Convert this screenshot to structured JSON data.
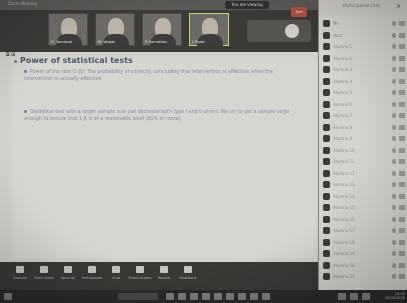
{
  "window": {
    "title": "Zoom Meeting",
    "share_banner": "You are viewing screen"
  },
  "gallery": {
    "tiles": [
      {
        "name": "G. Sandoval"
      },
      {
        "name": "M. Vargas"
      },
      {
        "name": "P. Sarmiento"
      },
      {
        "name": "J. Rojas"
      }
    ]
  },
  "slide": {
    "tools": "⧉ ⊞",
    "heading": "Power of statistical tests",
    "bullet_1": "Power of the test (1-β): The probability of correctly concluding that intervention is effective when the intervention is actually effective",
    "bullet_2": "Statistical test with a larger sample size can decrease both type I and II errors. We try to get a sample large enough to ensure that 1-β is at a reasonable level (80% or more)."
  },
  "toolbar": {
    "items": [
      {
        "label": "Unmute",
        "icon": "mic-icon"
      },
      {
        "label": "Start Video",
        "icon": "camera-icon"
      },
      {
        "label": "Security",
        "icon": "shield-icon"
      },
      {
        "label": "Participants",
        "icon": "people-icon"
      },
      {
        "label": "Chat",
        "icon": "chat-icon"
      },
      {
        "label": "Share Screen",
        "icon": "share-icon"
      },
      {
        "label": "Record",
        "icon": "record-icon"
      },
      {
        "label": "Reactions",
        "icon": "smile-icon"
      }
    ],
    "end_label": "End"
  },
  "panel": {
    "title": "Participants (14)",
    "close_glyph": "×",
    "participants": [
      {
        "name": "Me"
      },
      {
        "name": "Host"
      },
      {
        "name": "Alumno 1"
      },
      {
        "name": "Alumno 2"
      },
      {
        "name": "Alumno 3"
      },
      {
        "name": "Alumno 4"
      },
      {
        "name": "Alumno 5"
      },
      {
        "name": "Alumno 6"
      },
      {
        "name": "Alumno 7"
      },
      {
        "name": "Alumno 8"
      },
      {
        "name": "Alumno 9"
      },
      {
        "name": "Alumno 10"
      },
      {
        "name": "Alumno 11"
      },
      {
        "name": "Alumno 12"
      },
      {
        "name": "Alumno 13"
      },
      {
        "name": "Alumno 14"
      },
      {
        "name": "Alumno 15"
      },
      {
        "name": "Alumno 16"
      },
      {
        "name": "Alumno 17"
      },
      {
        "name": "Alumno 18"
      },
      {
        "name": "Alumno 19"
      },
      {
        "name": "Alumno 20"
      },
      {
        "name": "Alumno 21"
      }
    ]
  },
  "taskbar": {
    "time": "10:42",
    "date": "20/05/2020"
  }
}
